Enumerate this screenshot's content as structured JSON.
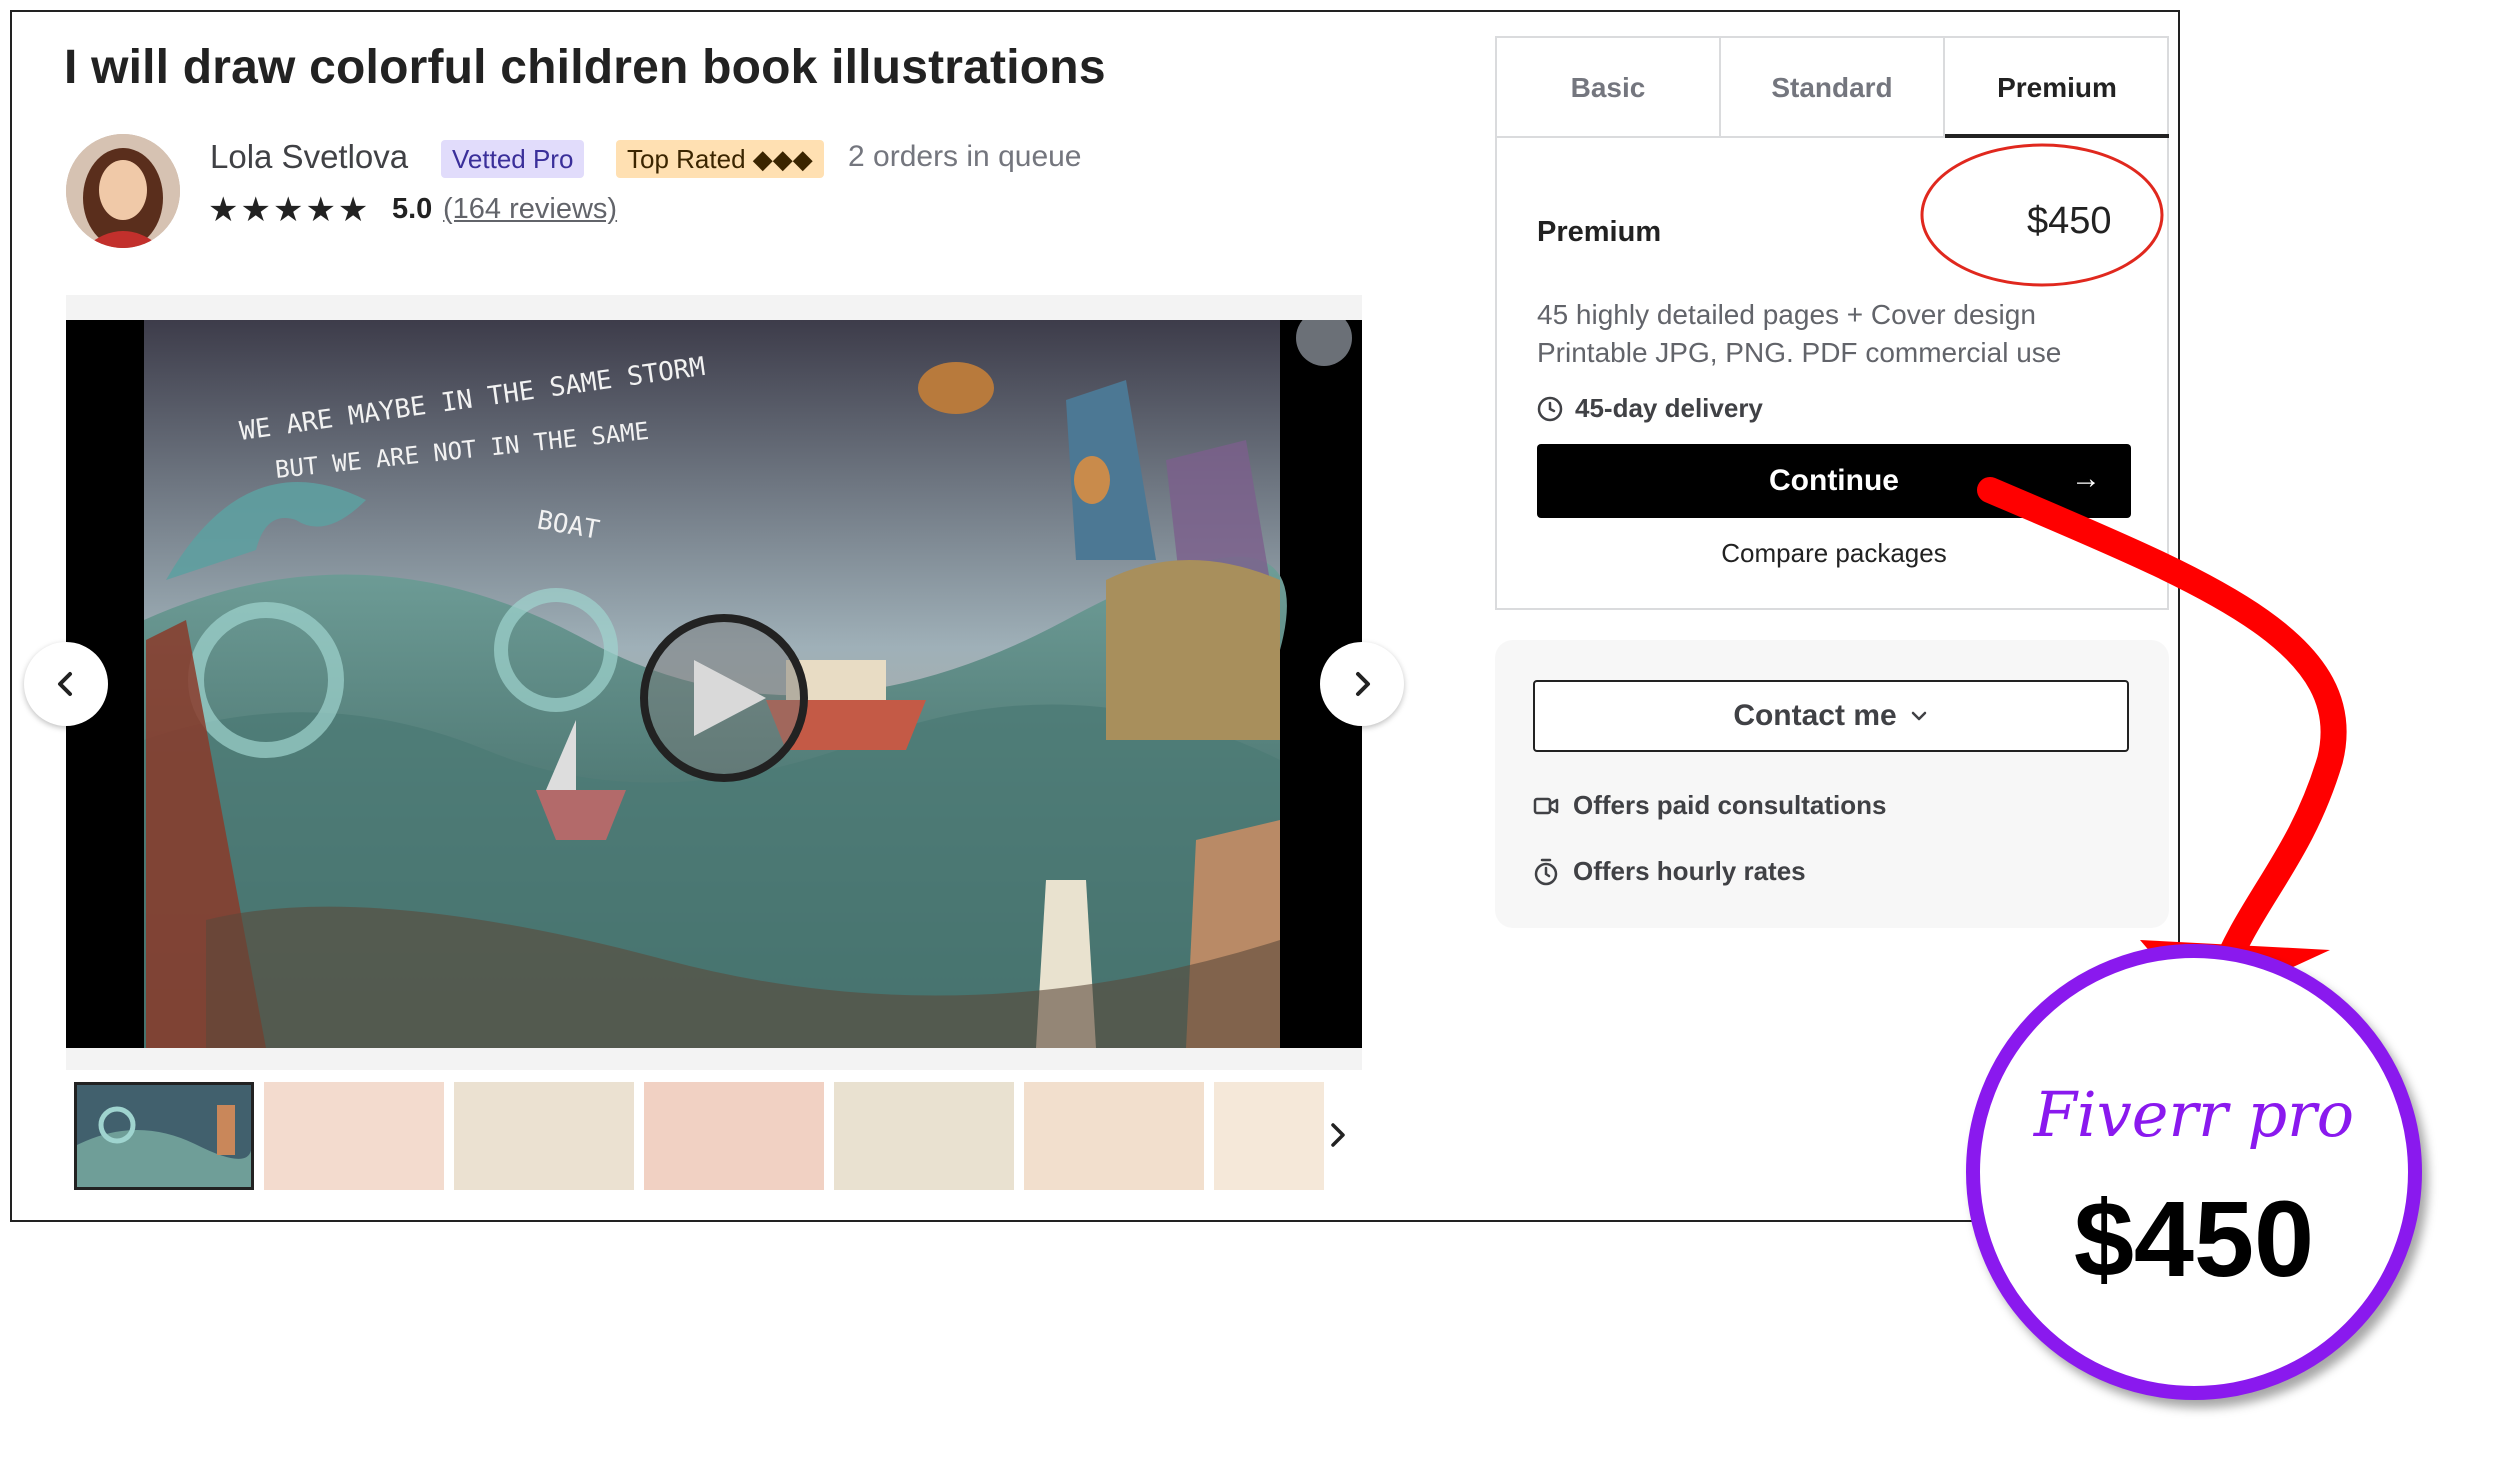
{
  "gig": {
    "title": "I will draw colorful children book illustrations"
  },
  "seller": {
    "name": "Lola Svetlova",
    "badge_vetted": "Vetted Pro",
    "badge_top_rated": "Top Rated ◆◆◆",
    "queue": "2 orders in queue",
    "stars": "★★★★★",
    "rating": "5.0",
    "reviews": "(164 reviews)"
  },
  "gallery": {
    "thumbnail_count": 7,
    "video_text": [
      "WE ARE MAYBE IN THE SAME STORM",
      "BUT WE ARE NOT IN THE SAME",
      "BOAT"
    ]
  },
  "packages": {
    "tabs": [
      "Basic",
      "Standard",
      "Premium"
    ],
    "selected_tab": "Premium",
    "name": "Premium",
    "price": "$450",
    "description_line1": "45 highly detailed pages + Cover design",
    "description_line2": "Printable JPG, PNG. PDF commercial use",
    "delivery": "45-day delivery",
    "continue_label": "Continue",
    "continue_arrow": "→",
    "compare_label": "Compare packages"
  },
  "contact": {
    "button_label": "Contact me",
    "offers": [
      "Offers paid consultations",
      "Offers hourly rates"
    ]
  },
  "annotation": {
    "label": "Fiverr pro",
    "price": "$450",
    "ring_color": "#e0281e",
    "arrow_color": "#ff0000",
    "circle_color": "#8a19ee"
  }
}
